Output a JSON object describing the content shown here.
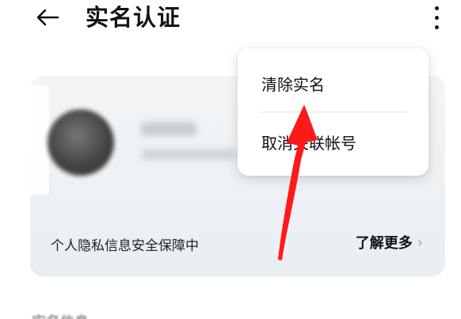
{
  "header": {
    "back_icon": "arrow-left-icon",
    "title": "实名认证",
    "more_icon": "more-vertical-icon"
  },
  "card": {
    "privacy_text": "个人隐私信息安全保障中",
    "learn_more_label": "了解更多",
    "chevron_icon": "chevron-right-icon",
    "chevron_glyph": "›"
  },
  "menu": {
    "items": [
      {
        "label": "清除实名"
      },
      {
        "label": "取消关联帐号"
      }
    ]
  },
  "section": {
    "label_partial": "实名信息"
  },
  "colors": {
    "annotation_arrow": "#ff1a1a",
    "card_background": "#eef1f4",
    "menu_background": "#ffffff"
  }
}
